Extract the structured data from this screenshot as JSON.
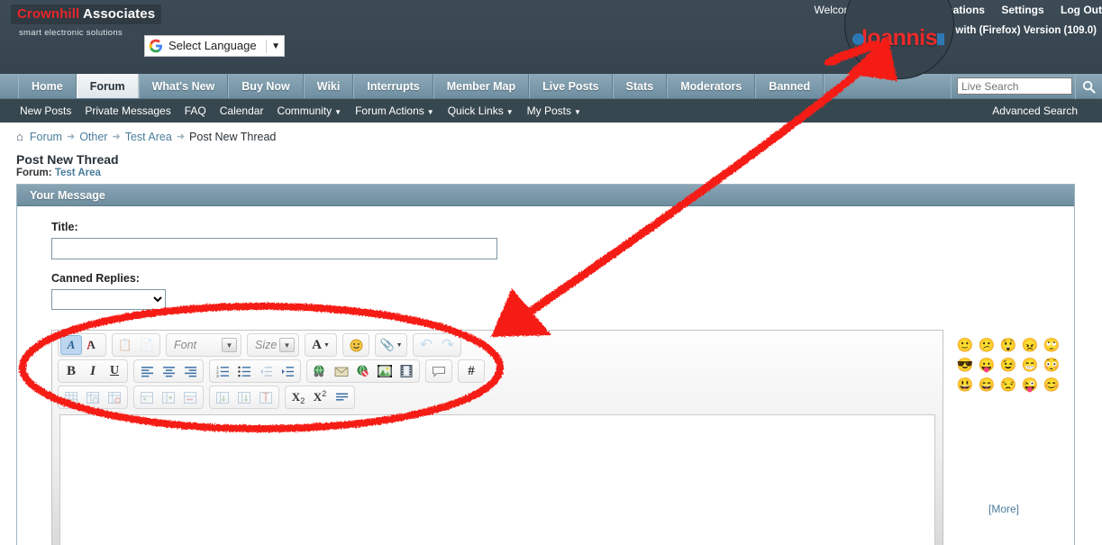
{
  "brand": {
    "name_red": "Crownhill",
    "name_white": "Associates",
    "tagline": "smart electronic solutions"
  },
  "translate": {
    "label": "Select Language",
    "caret": "▼",
    "icon": "google-icon"
  },
  "header": {
    "welcome": "Welcome,",
    "username": "Ioannis",
    "notifications": "Notifications",
    "settings": "Settings",
    "logout": "Log Out",
    "browser_note": "ng with (Firefox) Version (109.0)"
  },
  "annotation": {
    "magnified_username": "Ioannis",
    "marker_color": "#f51f14"
  },
  "nav": {
    "tabs": [
      {
        "label": "Home",
        "active": false
      },
      {
        "label": "Forum",
        "active": true
      },
      {
        "label": "What's New",
        "active": false
      },
      {
        "label": "Buy Now",
        "active": false
      },
      {
        "label": "Wiki",
        "active": false
      },
      {
        "label": "Interrupts",
        "active": false
      },
      {
        "label": "Member Map",
        "active": false
      },
      {
        "label": "Live Posts",
        "active": false
      },
      {
        "label": "Stats",
        "active": false
      },
      {
        "label": "Moderators",
        "active": false
      },
      {
        "label": "Banned",
        "active": false
      }
    ]
  },
  "search": {
    "placeholder": "Live Search",
    "value": "",
    "button_icon": "search-icon"
  },
  "subnav": {
    "items": [
      {
        "label": "New Posts",
        "caret": false
      },
      {
        "label": "Private Messages",
        "caret": false
      },
      {
        "label": "FAQ",
        "caret": false
      },
      {
        "label": "Calendar",
        "caret": false
      },
      {
        "label": "Community",
        "caret": true
      },
      {
        "label": "Forum Actions",
        "caret": true
      },
      {
        "label": "Quick Links",
        "caret": true
      },
      {
        "label": "My Posts",
        "caret": true
      }
    ],
    "advanced_search": "Advanced Search",
    "caret_glyph": "▼"
  },
  "breadcrumb": {
    "home_icon": "home-icon",
    "separator": "➜",
    "items": [
      {
        "label": "Forum",
        "link": true
      },
      {
        "label": "Other",
        "link": true
      },
      {
        "label": "Test Area",
        "link": true
      },
      {
        "label": "Post New Thread",
        "link": false
      }
    ]
  },
  "page": {
    "title": "Post New Thread",
    "forum_prefix": "Forum:",
    "forum_name": "Test Area"
  },
  "panel": {
    "heading": "Your Message"
  },
  "form": {
    "title_label": "Title:",
    "title_value": "",
    "canned_label": "Canned Replies:",
    "canned_value": "",
    "canned_options": [
      ""
    ]
  },
  "editor": {
    "font_placeholder": "Font",
    "size_placeholder": "Size",
    "rows": [
      {
        "groups": [
          {
            "buttons": [
              {
                "name": "remove-formatting-icon",
                "glyph": "A",
                "state": "selected"
              },
              {
                "name": "strip-font-color-icon",
                "glyph": "A",
                "state": "normal"
              }
            ]
          },
          {
            "buttons": [
              {
                "name": "paste-icon",
                "glyph": "⎘",
                "state": "disabled"
              },
              {
                "name": "paste-from-word-icon",
                "glyph": "⎘",
                "state": "disabled"
              }
            ]
          },
          {
            "buttons": [
              {
                "name": "font-family-select",
                "glyph": "Font",
                "state": "combo"
              }
            ]
          },
          {
            "buttons": [
              {
                "name": "font-size-select",
                "glyph": "Size",
                "state": "combo"
              }
            ]
          },
          {
            "buttons": [
              {
                "name": "font-color-icon",
                "glyph": "A",
                "state": "normal"
              }
            ]
          },
          {
            "buttons": [
              {
                "name": "highlight-color-icon",
                "glyph": "🙂",
                "state": "normal"
              }
            ]
          },
          {
            "buttons": [
              {
                "name": "attachment-icon",
                "glyph": "✐",
                "state": "normal"
              }
            ]
          },
          {
            "buttons": [
              {
                "name": "undo-icon",
                "glyph": "↩",
                "state": "disabled"
              },
              {
                "name": "redo-icon",
                "glyph": "↪",
                "state": "disabled"
              }
            ]
          }
        ]
      },
      {
        "groups": [
          {
            "buttons": [
              {
                "name": "bold-icon",
                "glyph": "B",
                "state": "normal"
              },
              {
                "name": "italic-icon",
                "glyph": "I",
                "state": "normal"
              },
              {
                "name": "underline-icon",
                "glyph": "U",
                "state": "normal"
              }
            ]
          },
          {
            "buttons": [
              {
                "name": "align-left-icon",
                "glyph": "≡",
                "state": "normal"
              },
              {
                "name": "align-center-icon",
                "glyph": "≡",
                "state": "normal"
              },
              {
                "name": "align-right-icon",
                "glyph": "≡",
                "state": "normal"
              }
            ]
          },
          {
            "buttons": [
              {
                "name": "ordered-list-icon",
                "glyph": "≡",
                "state": "normal"
              },
              {
                "name": "unordered-list-icon",
                "glyph": "≡",
                "state": "normal"
              },
              {
                "name": "outdent-icon",
                "glyph": "≡",
                "state": "disabled"
              },
              {
                "name": "indent-icon",
                "glyph": "≡",
                "state": "normal"
              }
            ]
          },
          {
            "buttons": [
              {
                "name": "insert-link-icon",
                "glyph": "🌐",
                "state": "normal"
              },
              {
                "name": "insert-email-icon",
                "glyph": "✉",
                "state": "normal"
              },
              {
                "name": "remove-link-icon",
                "glyph": "🌐",
                "state": "normal"
              },
              {
                "name": "insert-image-icon",
                "glyph": "🖼",
                "state": "normal"
              },
              {
                "name": "insert-video-icon",
                "glyph": "🎞",
                "state": "normal"
              }
            ]
          },
          {
            "buttons": [
              {
                "name": "insert-quote-icon",
                "glyph": "💬",
                "state": "normal"
              }
            ]
          },
          {
            "buttons": [
              {
                "name": "insert-code-icon",
                "glyph": "#",
                "state": "normal"
              }
            ]
          }
        ]
      },
      {
        "groups": [
          {
            "buttons": [
              {
                "name": "insert-table-icon",
                "glyph": "▦",
                "state": "disabled"
              },
              {
                "name": "table-properties-icon",
                "glyph": "▦",
                "state": "disabled"
              },
              {
                "name": "delete-table-icon",
                "glyph": "▦",
                "state": "disabled"
              }
            ]
          },
          {
            "buttons": [
              {
                "name": "insert-row-icon",
                "glyph": "▤",
                "state": "disabled"
              },
              {
                "name": "insert-column-icon",
                "glyph": "▥",
                "state": "disabled"
              },
              {
                "name": "delete-row-icon",
                "glyph": "▤",
                "state": "disabled"
              }
            ]
          },
          {
            "buttons": [
              {
                "name": "merge-cells-icon",
                "glyph": "▥",
                "state": "disabled"
              },
              {
                "name": "split-cell-icon",
                "glyph": "▥",
                "state": "disabled"
              },
              {
                "name": "delete-column-icon",
                "glyph": "▥",
                "state": "disabled"
              }
            ]
          },
          {
            "buttons": [
              {
                "name": "subscript-icon",
                "glyph": "X₂",
                "state": "normal"
              },
              {
                "name": "superscript-icon",
                "glyph": "X²",
                "state": "normal"
              },
              {
                "name": "horizontal-rule-icon",
                "glyph": "≡",
                "state": "normal"
              }
            ]
          }
        ]
      }
    ],
    "body_value": ""
  },
  "smilies": {
    "more_label": "[More]",
    "items": [
      {
        "name": "smiley-smile",
        "glyph": "🙂"
      },
      {
        "name": "smiley-confused",
        "glyph": "😕"
      },
      {
        "name": "smiley-eek",
        "glyph": "😲"
      },
      {
        "name": "smiley-mad",
        "glyph": "😠"
      },
      {
        "name": "smiley-rolleyes",
        "glyph": "🙄"
      },
      {
        "name": "smiley-cool",
        "glyph": "😎"
      },
      {
        "name": "smiley-tongue",
        "glyph": "😛"
      },
      {
        "name": "smiley-wink",
        "glyph": "😉"
      },
      {
        "name": "smiley-biggrin",
        "glyph": "😁"
      },
      {
        "name": "smiley-redface",
        "glyph": "😳"
      },
      {
        "name": "smiley-grin",
        "glyph": "😃"
      },
      {
        "name": "smiley-happy",
        "glyph": "😄"
      },
      {
        "name": "smiley-frown",
        "glyph": "😒"
      },
      {
        "name": "smiley-razz",
        "glyph": "😜"
      },
      {
        "name": "smiley-relaxed",
        "glyph": "😊"
      }
    ]
  }
}
